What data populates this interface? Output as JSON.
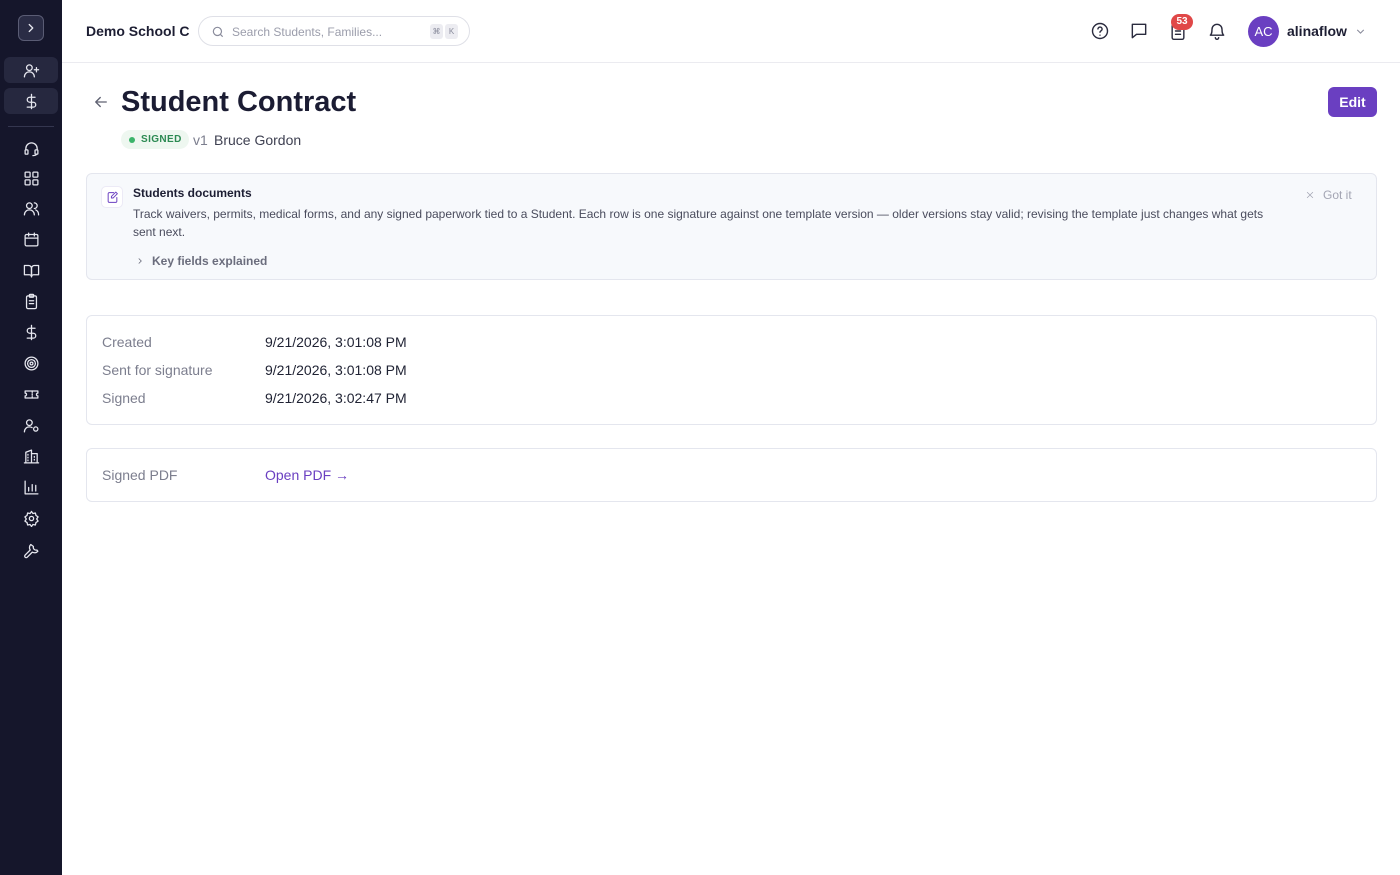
{
  "header": {
    "school_name": "Demo School C",
    "search_placeholder": "Search Students, Families...",
    "shortcut_keys": [
      "⌘",
      "K"
    ],
    "notification_count": "53",
    "user_initials": "AC",
    "username": "alinaflow"
  },
  "page": {
    "title": "Student Contract",
    "status": "SIGNED",
    "version": "v1",
    "student_name": "Bruce Gordon",
    "edit_label": "Edit"
  },
  "callout": {
    "title": "Students documents",
    "body": "Track waivers, permits, medical forms, and any signed paperwork tied to a Student. Each row is one signature against one template version — older versions stay valid; revising the template just changes what gets sent next.",
    "dismiss_label": "Got it",
    "expand_label": "Key fields explained"
  },
  "details": {
    "created_label": "Created",
    "created_value": "9/21/2026, 3:01:08 PM",
    "sent_label": "Sent for signature",
    "sent_value": "9/21/2026, 3:01:08 PM",
    "signed_label": "Signed",
    "signed_value": "9/21/2026, 3:02:47 PM"
  },
  "pdf": {
    "label": "Signed PDF",
    "link_text": "Open PDF →"
  },
  "colors": {
    "sidebar": "#15162b",
    "accent": "#6a3fc1",
    "status_green": "#2b8a52",
    "badge_red": "#e04848"
  },
  "sidebar_icons": [
    "chevron-right-icon",
    "user-plus-icon",
    "dollar-icon",
    "headset-icon",
    "dashboard-icon",
    "users-icon",
    "calendar-icon",
    "book-icon",
    "clipboard-icon",
    "dollar-icon",
    "target-icon",
    "ticket-icon",
    "user-cog-icon",
    "building-icon",
    "bar-chart-icon",
    "gear-icon",
    "wrench-icon"
  ]
}
